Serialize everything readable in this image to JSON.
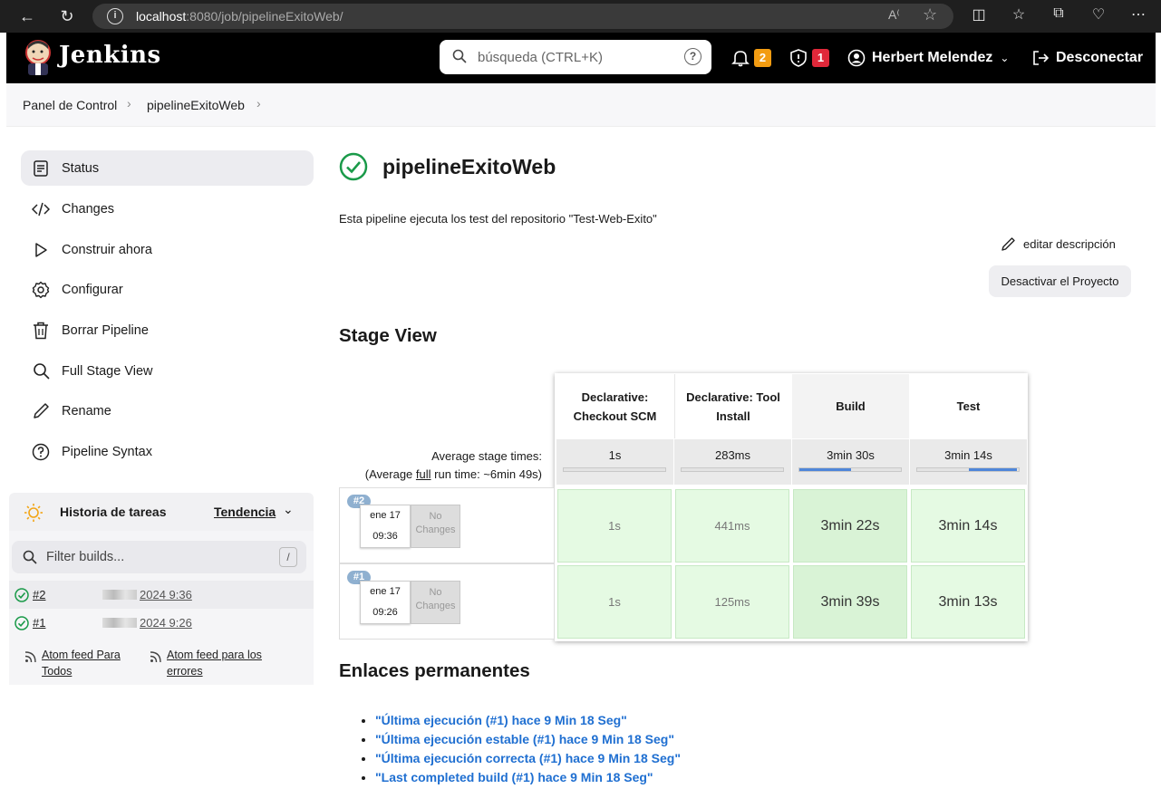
{
  "browser": {
    "url_host": "localhost",
    "url_rest": ":8080/job/pipelineExitoWeb/"
  },
  "header": {
    "logo_text": "Jenkins",
    "search_placeholder": "búsqueda (CTRL+K)",
    "notifications_count": "2",
    "security_count": "1",
    "user_name": "Herbert Melendez",
    "logout_label": "Desconectar"
  },
  "breadcrumb": [
    "Panel de Control",
    "pipelineExitoWeb"
  ],
  "sidebar": {
    "items": [
      {
        "label": "Status",
        "icon": "status-icon"
      },
      {
        "label": "Changes",
        "icon": "code-icon"
      },
      {
        "label": "Construir ahora",
        "icon": "play-icon"
      },
      {
        "label": "Configurar",
        "icon": "gear-icon"
      },
      {
        "label": "Borrar Pipeline",
        "icon": "trash-icon"
      },
      {
        "label": "Full Stage View",
        "icon": "search-icon"
      },
      {
        "label": "Rename",
        "icon": "pencil-icon"
      },
      {
        "label": "Pipeline Syntax",
        "icon": "help-icon"
      }
    ],
    "history": {
      "title": "Historia de tareas",
      "trend": "Tendencia",
      "filter_placeholder": "Filter builds...",
      "filter_shortcut": "/",
      "builds": [
        {
          "num": "#2",
          "date": "2024 9:36"
        },
        {
          "num": "#1",
          "date": "2024 9:26"
        }
      ],
      "feed_all": "Atom feed Para Todos",
      "feed_errors": "Atom feed para los errores"
    }
  },
  "main": {
    "title": "pipelineExitoWeb",
    "description": "Esta pipeline ejecuta los test del repositorio \"Test-Web-Exito\"",
    "edit_description": "editar descripción",
    "disable_button": "Desactivar el Proyecto",
    "stage_view_title": "Stage View",
    "avg_label_1": "Average stage times:",
    "avg_label_2_pre": "(Average ",
    "avg_label_2_link": "full",
    "avg_label_2_post": " run time: ~6min 49s)",
    "stages": [
      {
        "name": "Declarative: Checkout SCM",
        "avg": "1s",
        "avg_fraction": 0.0
      },
      {
        "name": "Declarative: Tool Install",
        "avg": "283ms",
        "avg_fraction": 0.0
      },
      {
        "name": "Build",
        "avg": "3min 30s",
        "avg_fraction": 0.51
      },
      {
        "name": "Test",
        "avg": "3min 14s",
        "avg_fraction": 0.47
      }
    ],
    "runs": [
      {
        "badge": "#2",
        "date": "ene 17",
        "time": "09:36",
        "changes": "No Changes",
        "durations": [
          "1s",
          "441ms",
          "3min 22s",
          "3min 14s"
        ]
      },
      {
        "badge": "#1",
        "date": "ene 17",
        "time": "09:26",
        "changes": "No Changes",
        "durations": [
          "1s",
          "125ms",
          "3min 39s",
          "3min 13s"
        ]
      }
    ],
    "permalinks_title": "Enlaces permanentes",
    "permalinks": [
      "\"Última ejecución (#1) hace 9 Min 18 Seg\"",
      "\"Última ejecución estable (#1) hace 9 Min 18 Seg\"",
      "\"Última ejecución correcta (#1) hace 9 Min 18 Seg\"",
      "\"Last completed build (#1) hace 9 Min 18 Seg\""
    ]
  }
}
